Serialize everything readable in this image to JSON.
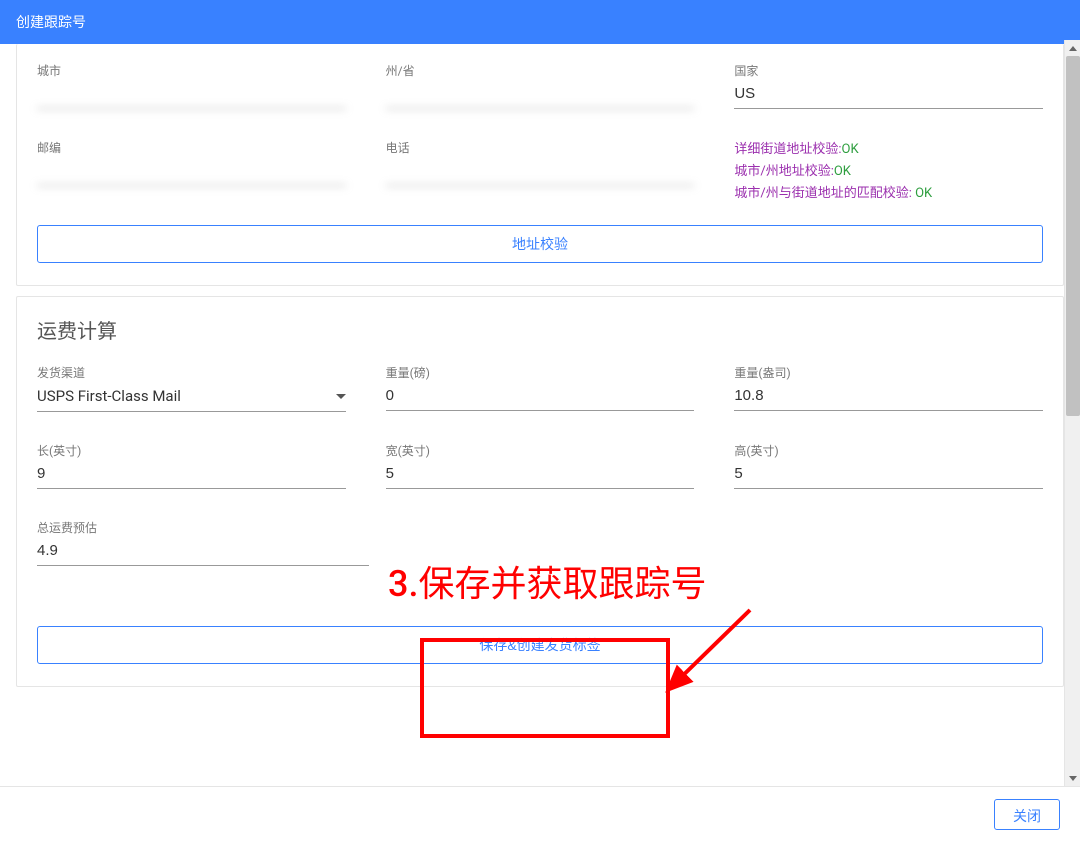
{
  "header": {
    "title": "创建跟踪号"
  },
  "address": {
    "city": {
      "label": "城市",
      "value": ""
    },
    "state": {
      "label": "州/省",
      "value": ""
    },
    "country": {
      "label": "国家",
      "value": "US"
    },
    "postal": {
      "label": "邮编",
      "value": ""
    },
    "phone": {
      "label": "电话",
      "value": ""
    },
    "validations": [
      {
        "label": "详细街道地址校验:",
        "status": "OK"
      },
      {
        "label": "城市/州地址校验:",
        "status": "OK"
      },
      {
        "label": "城市/州与街道地址的匹配校验:",
        "status": " OK"
      }
    ],
    "validate_button": "地址校验"
  },
  "shipping": {
    "section_title": "运费计算",
    "channel": {
      "label": "发货渠道",
      "value": "USPS First-Class Mail"
    },
    "weight_lb": {
      "label": "重量(磅)",
      "value": "0"
    },
    "weight_oz": {
      "label": "重量(盎司)",
      "value": "10.8"
    },
    "length": {
      "label": "长(英寸)",
      "value": "9"
    },
    "width": {
      "label": "宽(英寸)",
      "value": "5"
    },
    "height": {
      "label": "高(英寸)",
      "value": "5"
    },
    "estimate": {
      "label": "总运费预估",
      "value": "4.9"
    },
    "save_button": "保存&创建发货标签"
  },
  "footer": {
    "close_label": "关闭"
  },
  "annotation": {
    "text": "3.保存并获取跟踪号"
  }
}
